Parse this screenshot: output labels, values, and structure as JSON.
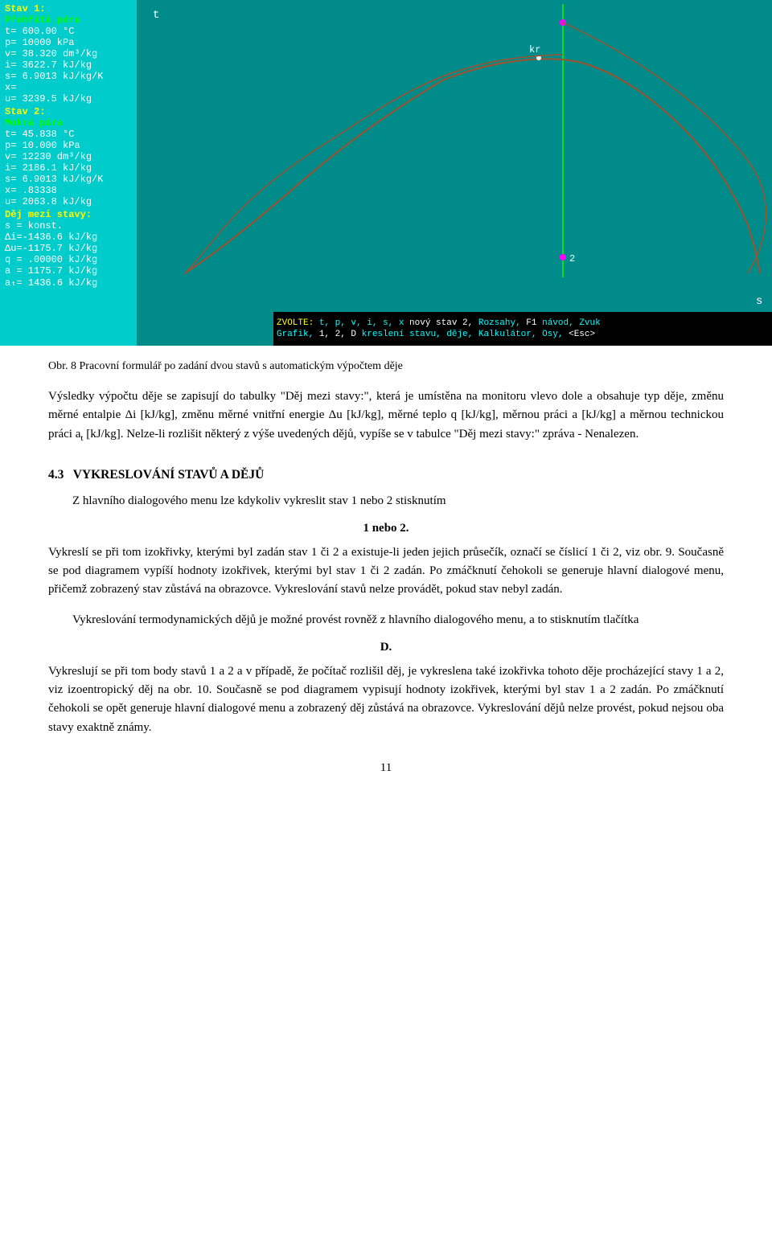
{
  "screenshot": {
    "left_panel": {
      "stav1_heading": "Stav 1:",
      "stav1_sub": "Přehřátá pára",
      "t1": "t= 600.00 °C",
      "p1": "p= 10000  kPa",
      "v1": "v= 38.320 dm³/kg",
      "i1": "i= 3622.7 kJ/kg",
      "s1": "s= 6.9013 kJ/kg/K",
      "x1": "x=",
      "u1": "u= 3239.5 kJ/kg",
      "stav2_heading": "Stav 2:",
      "stav2_sub": "Mokrá pára",
      "t2": "t= 45.838 °C",
      "p2": "p= 10.000 kPa",
      "v2": "v= 12230  dm³/kg",
      "i2": "i= 2186.1 kJ/kg",
      "s2": "s= 6.9013 kJ/kg/K",
      "x2": "x= .83338",
      "u2": "u= 2063.8 kJ/kg",
      "dej_heading": "Děj mezi stavy:",
      "s_konst": "s = konst.",
      "delta_i": "Δi=-1436.6 kJ/kg",
      "delta_u": "Δu=-1175.7 kJ/kg",
      "q": "q =  .00000 kJ/kg",
      "a": "a = 1175.7 kJ/kg",
      "at": "aₜ= 1436.6 kJ/kg"
    },
    "menu1": "ZVOLTE:  t, p, v, i, s, x nový stav 2,  Rozsahy,  F1 návod, Zvuk",
    "menu2": "Grafik,  1, 2, D kreslení stavu, děje, Kalkulátor, Osy,  <Esc>",
    "diagram_labels": {
      "t_axis": "t",
      "s_axis": "s",
      "kr_label": "kr",
      "point2_label": "2"
    }
  },
  "caption": {
    "text": "Obr. 8 Pracovní formulář po zadání dvou stavů s automatickým výpočtem děje"
  },
  "paragraphs": {
    "p1": "Výsledky výpočtu děje se zapisují do tabulky \"Děj mezi stavy:\", která je umístěna na monitoru vlevo dole a obsahuje typ děje, změnu měrné entalpie Δi [kJ/kg], změnu měrné vnitřní energie Δu [kJ/kg], měrné teplo q [kJ/kg], měrnou práci a [kJ/kg] a měrnou technickou práci a",
    "p1_sub": "t",
    "p1_end": " [kJ/kg]. Nelze-li rozlišit některý z výše uvedených dějů, vypíše se v tabulce \"Děj mezi stavy:\" zpráva - Nenalezen.",
    "section_num": "4.3",
    "section_title": "VYKRESLOVÁNÍ STAVŮ A DĚJŮ",
    "section_intro": "Z hlavního dialogového menu lze kdykoliv vykreslit stav 1 nebo 2 stisknutím",
    "one_or_two": "1 nebo 2.",
    "p2": "Vykreslí se při tom izokřivky, kterými byl zadán stav 1 či 2 a existuje-li jeden jejich průsečík, označí se číslicí 1 či 2, viz obr. 9. Současně se pod diagramem vypíší hodnoty izokřivek, kterými byl stav 1 či 2 zadán. Po zmáčknutí čehokoli se generuje hlavní dialogové menu, přičemž zobrazený stav zůstává na obrazovce. Vykreslování stavů nelze provádět, pokud stav nebyl zadán.",
    "p3_indent": "Vykreslování termodynamických dějů je možné provést rovněž z hlavního dialogového menu, a to stisknutím tlačítka",
    "d_label": "D.",
    "p4": "Vykreslují se při tom body stavů 1 a 2 a v případě, že počítač rozlišil děj, je vykreslena také izokřivka tohoto děje procházející stavy 1 a 2, viz izoentropický děj na obr. 10. Současně se pod diagramem vypisují hodnoty izokřivek, kterými byl stav 1 a 2 zadán. Po zmáčknutí čehokoli se opět generuje hlavní dialogové menu a zobrazený děj zůstává na obrazovce. Vykreslování dějů nelze provést, pokud nejsou oba stavy exaktně známy.",
    "page_number": "11"
  }
}
